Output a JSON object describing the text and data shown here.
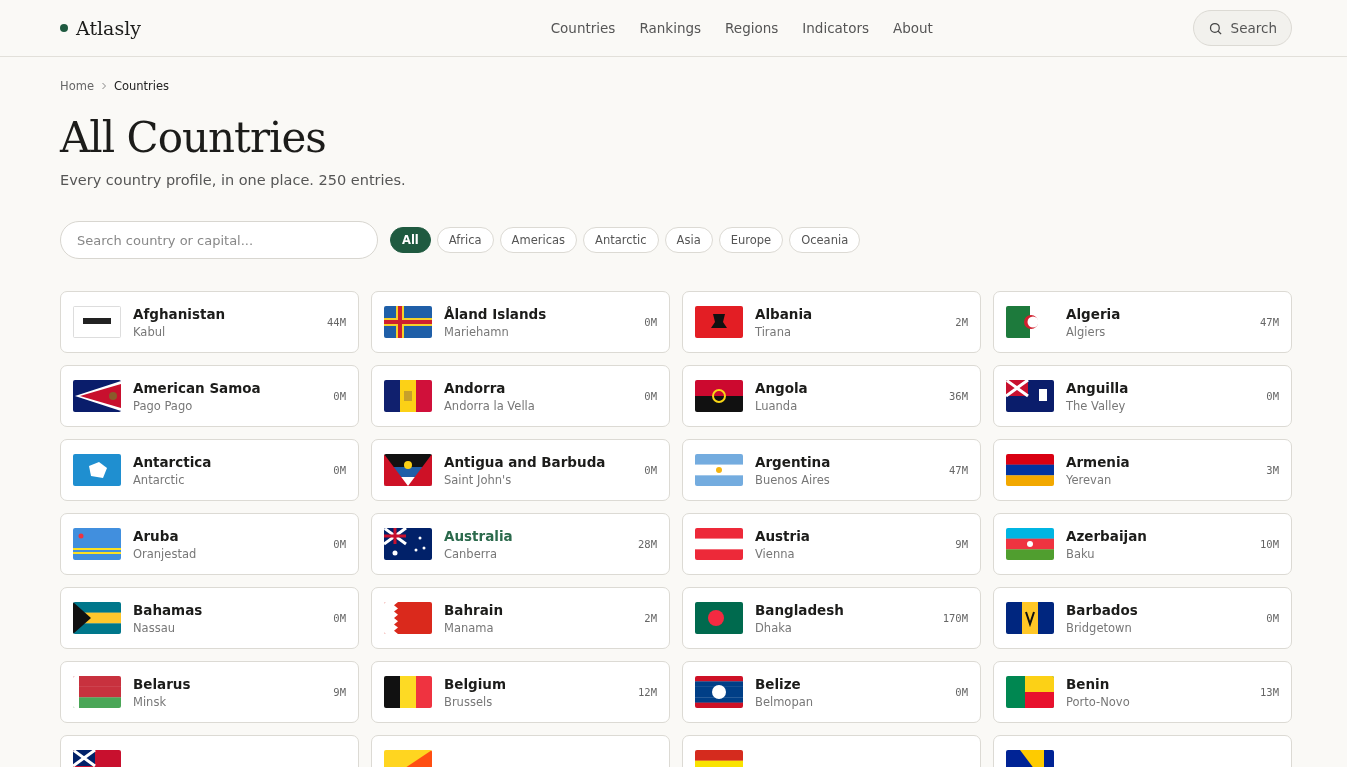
{
  "header": {
    "logo": "Atlasly",
    "nav": [
      {
        "label": "Countries"
      },
      {
        "label": "Rankings"
      },
      {
        "label": "Regions"
      },
      {
        "label": "Indicators"
      },
      {
        "label": "About"
      }
    ],
    "search_button": "Search"
  },
  "breadcrumb": [
    {
      "label": "Home"
    },
    {
      "label": "Countries"
    }
  ],
  "title": "All Countries",
  "subtitle": "Every country profile, in one place. 250 entries.",
  "search": {
    "placeholder": "Search country or capital..."
  },
  "filters": [
    {
      "label": "All",
      "selected": true
    },
    {
      "label": "Africa",
      "selected": false
    },
    {
      "label": "Americas",
      "selected": false
    },
    {
      "label": "Antarctic",
      "selected": false
    },
    {
      "label": "Asia",
      "selected": false
    },
    {
      "label": "Europe",
      "selected": false
    },
    {
      "label": "Oceania",
      "selected": false
    }
  ],
  "countries": [
    {
      "name": "Afghanistan",
      "capital": "Kabul",
      "population": "44M",
      "hovered": false
    },
    {
      "name": "Åland Islands",
      "capital": "Mariehamn",
      "population": "0M",
      "hovered": false
    },
    {
      "name": "Albania",
      "capital": "Tirana",
      "population": "2M",
      "hovered": false
    },
    {
      "name": "Algeria",
      "capital": "Algiers",
      "population": "47M",
      "hovered": false
    },
    {
      "name": "American Samoa",
      "capital": "Pago Pago",
      "population": "0M",
      "hovered": false
    },
    {
      "name": "Andorra",
      "capital": "Andorra la Vella",
      "population": "0M",
      "hovered": false
    },
    {
      "name": "Angola",
      "capital": "Luanda",
      "population": "36M",
      "hovered": false
    },
    {
      "name": "Anguilla",
      "capital": "The Valley",
      "population": "0M",
      "hovered": false
    },
    {
      "name": "Antarctica",
      "capital": "Antarctic",
      "population": "0M",
      "hovered": false
    },
    {
      "name": "Antigua and Barbuda",
      "capital": "Saint John's",
      "population": "0M",
      "hovered": false
    },
    {
      "name": "Argentina",
      "capital": "Buenos Aires",
      "population": "47M",
      "hovered": false
    },
    {
      "name": "Armenia",
      "capital": "Yerevan",
      "population": "3M",
      "hovered": false
    },
    {
      "name": "Aruba",
      "capital": "Oranjestad",
      "population": "0M",
      "hovered": false
    },
    {
      "name": "Australia",
      "capital": "Canberra",
      "population": "28M",
      "hovered": true
    },
    {
      "name": "Austria",
      "capital": "Vienna",
      "population": "9M",
      "hovered": false
    },
    {
      "name": "Azerbaijan",
      "capital": "Baku",
      "population": "10M",
      "hovered": false
    },
    {
      "name": "Bahamas",
      "capital": "Nassau",
      "population": "0M",
      "hovered": false
    },
    {
      "name": "Bahrain",
      "capital": "Manama",
      "population": "2M",
      "hovered": false
    },
    {
      "name": "Bangladesh",
      "capital": "Dhaka",
      "population": "170M",
      "hovered": false
    },
    {
      "name": "Barbados",
      "capital": "Bridgetown",
      "population": "0M",
      "hovered": false
    },
    {
      "name": "Belarus",
      "capital": "Minsk",
      "population": "9M",
      "hovered": false
    },
    {
      "name": "Belgium",
      "capital": "Brussels",
      "population": "12M",
      "hovered": false
    },
    {
      "name": "Belize",
      "capital": "Belmopan",
      "population": "0M",
      "hovered": false
    },
    {
      "name": "Benin",
      "capital": "Porto-Novo",
      "population": "13M",
      "hovered": false
    }
  ]
}
